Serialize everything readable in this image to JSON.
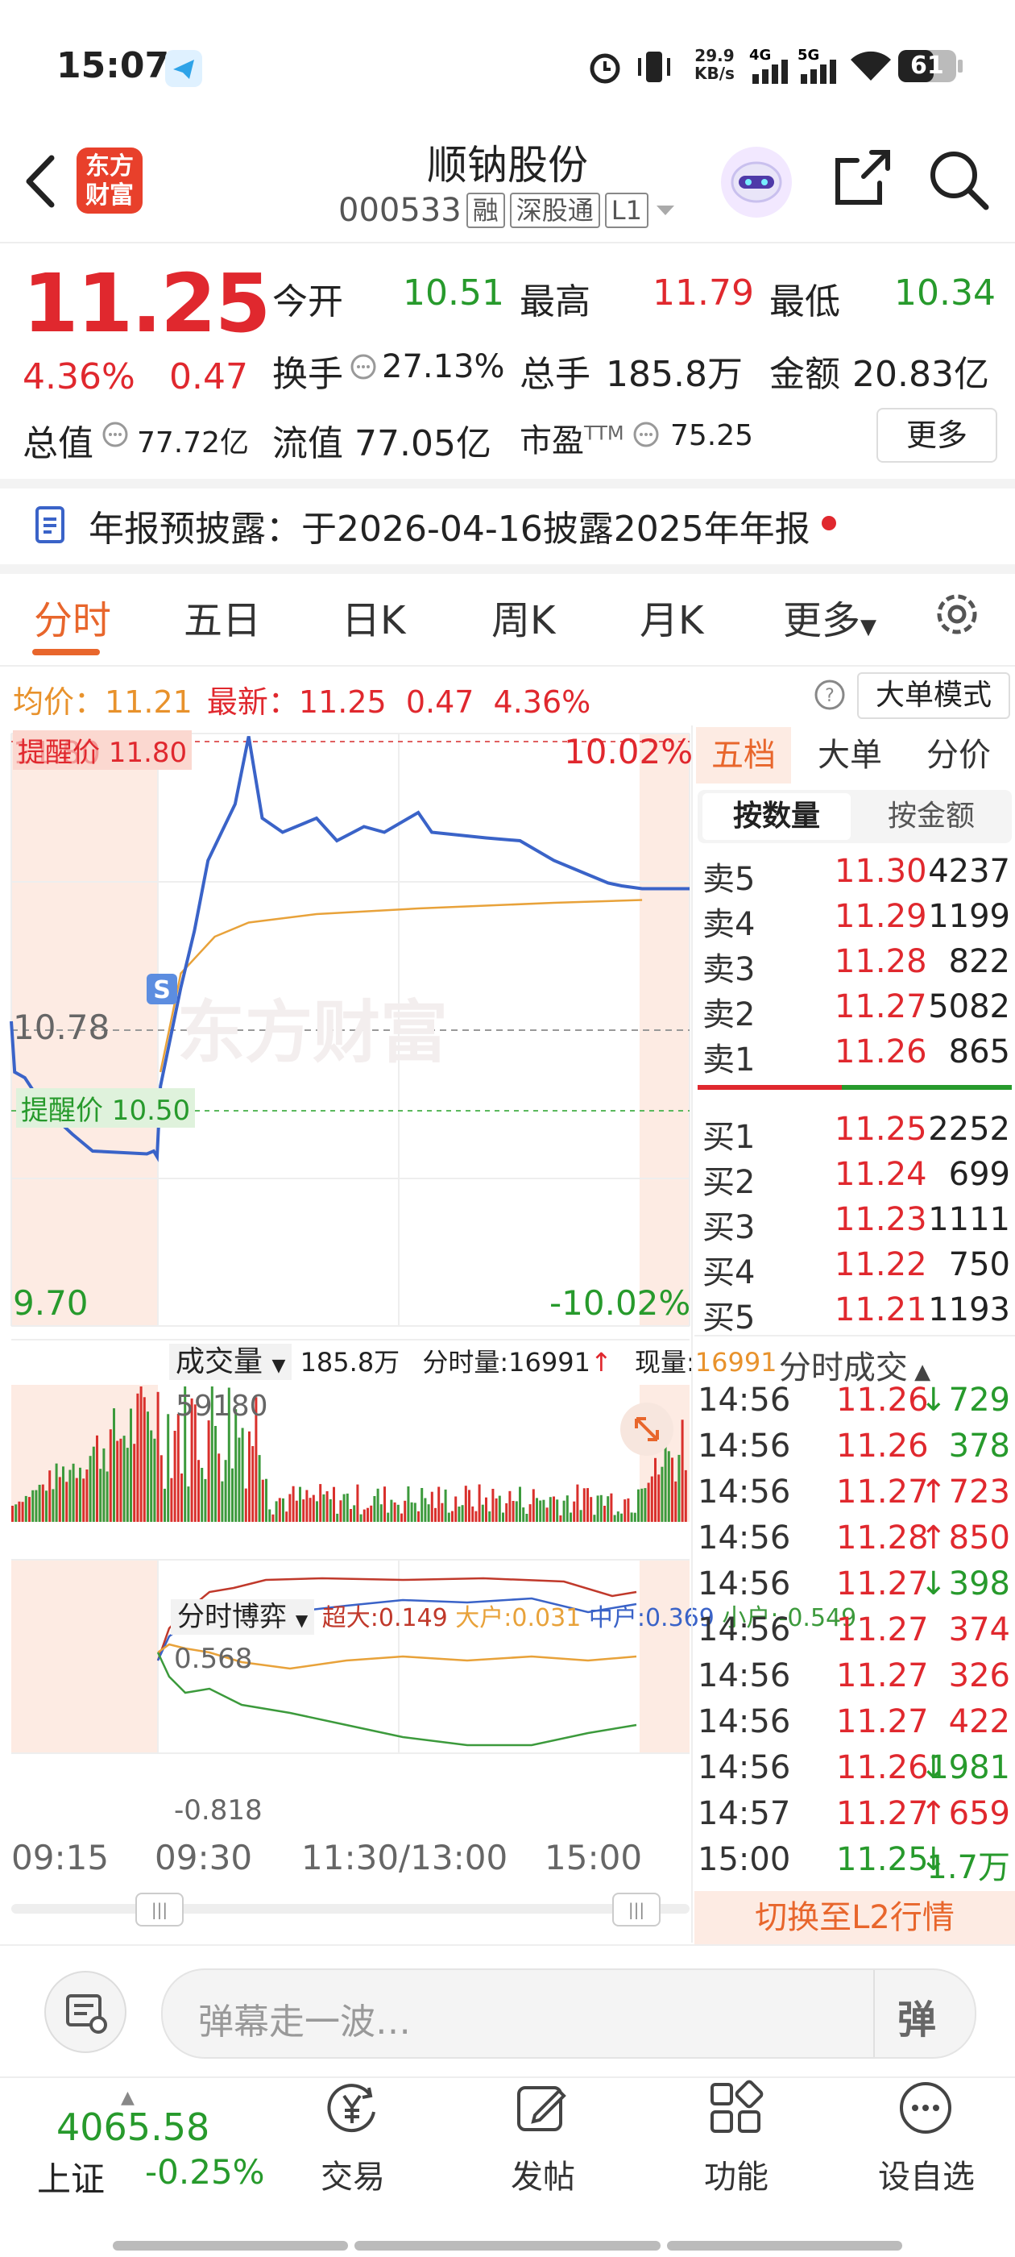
{
  "status_bar": {
    "time": "15:07",
    "net_speed_value": "29.9",
    "net_speed_unit": "KB/s",
    "net_4g": "4G",
    "net_5g": "5G",
    "battery": "61"
  },
  "header": {
    "title": "顺钠股份",
    "code": "000533",
    "tags": [
      "融",
      "深股通",
      "L1"
    ],
    "logo_text": "东方\n财富"
  },
  "quote": {
    "price": "11.25",
    "change_pct": "4.36%",
    "change": "0.47",
    "open_label": "今开",
    "open": "10.51",
    "high_label": "最高",
    "high": "11.79",
    "low_label": "最低",
    "low": "10.34",
    "turnover_label": "换手",
    "turnover": "27.13%",
    "volume_label": "总手",
    "volume": "185.8万",
    "amount_label": "金额",
    "amount": "20.83亿",
    "mcap_label": "总值",
    "mcap": "77.72亿",
    "float_label": "流值",
    "float": "77.05亿",
    "pe_label": "市盈",
    "pe_sup": "TTM",
    "pe": "75.25",
    "more_label": "更多"
  },
  "notice": {
    "text": "年报预披露：于2026-04-16披露2025年年报"
  },
  "tabs": [
    {
      "label": "分时",
      "active": true
    },
    {
      "label": "五日"
    },
    {
      "label": "日K"
    },
    {
      "label": "周K"
    },
    {
      "label": "月K"
    },
    {
      "label": "更多"
    }
  ],
  "info_line": {
    "avg_label": "均价：",
    "avg": "11.21",
    "last_label": "最新：",
    "last": "11.25",
    "chg": "0.47",
    "pct": "4.36%",
    "mode_button": "大单模式"
  },
  "chart_labels": {
    "top_price": "11.80",
    "alert_high": "提醒价 11.80",
    "top_pct": "10.02%",
    "mid_price": "10.78",
    "alert_low": "提醒价 10.50",
    "bottom_price": "9.70",
    "bottom_pct": "-10.02%",
    "watermark": "东方财富",
    "s_marker": "S"
  },
  "volume_bar": {
    "selector": "成交量",
    "total": "185.8万",
    "tick_label": "分时量:",
    "tick_value": "16991",
    "now_label": "现量:",
    "now_value": "16991",
    "max_label": "59180"
  },
  "game_bar": {
    "selector": "分时博弈",
    "super_label": "超大:",
    "super": "0.149",
    "big_label": "大户:",
    "big": "0.031",
    "mid_label": "中户:",
    "mid": "0.369",
    "small_label": "小户:",
    "small": "-0.549",
    "top_value": "0.568",
    "bottom_value": "-0.818"
  },
  "time_axis": [
    "09:15",
    "09:30",
    "11:30/13:00",
    "15:00"
  ],
  "chart_data": {
    "type": "line",
    "series": [],
    "price_points": [
      [
        0,
        10.78
      ],
      [
        0.005,
        10.6
      ],
      [
        0.02,
        10.58
      ],
      [
        0.05,
        10.47
      ],
      [
        0.09,
        10.38
      ],
      [
        0.12,
        10.32
      ],
      [
        0.2,
        10.31
      ],
      [
        0.21,
        10.32
      ],
      [
        0.215,
        10.3
      ],
      [
        0.22,
        10.55
      ],
      [
        0.25,
        10.9
      ],
      [
        0.27,
        11.1
      ],
      [
        0.29,
        11.35
      ],
      [
        0.31,
        11.45
      ],
      [
        0.33,
        11.55
      ],
      [
        0.35,
        11.79
      ],
      [
        0.37,
        11.5
      ],
      [
        0.4,
        11.45
      ],
      [
        0.45,
        11.5
      ],
      [
        0.48,
        11.42
      ],
      [
        0.52,
        11.47
      ],
      [
        0.55,
        11.45
      ],
      [
        0.6,
        11.52
      ],
      [
        0.62,
        11.45
      ],
      [
        0.7,
        11.43
      ],
      [
        0.75,
        11.42
      ],
      [
        0.8,
        11.35
      ],
      [
        0.85,
        11.3
      ],
      [
        0.88,
        11.27
      ],
      [
        0.9,
        11.26
      ],
      [
        0.93,
        11.25
      ],
      [
        1,
        11.25
      ]
    ],
    "avg_points": [
      [
        0.22,
        10.6
      ],
      [
        0.25,
        10.95
      ],
      [
        0.3,
        11.08
      ],
      [
        0.35,
        11.13
      ],
      [
        0.45,
        11.16
      ],
      [
        0.6,
        11.18
      ],
      [
        0.8,
        11.2
      ],
      [
        0.93,
        11.21
      ]
    ],
    "ylim": [
      9.7,
      11.8
    ]
  },
  "order_book": {
    "tabs": [
      "五档",
      "大单",
      "分价"
    ],
    "sub_tabs": [
      "按数量",
      "按金额"
    ],
    "asks": [
      {
        "label": "卖5",
        "price": "11.30",
        "qty": "4237"
      },
      {
        "label": "卖4",
        "price": "11.29",
        "qty": "1199"
      },
      {
        "label": "卖3",
        "price": "11.28",
        "qty": "822"
      },
      {
        "label": "卖2",
        "price": "11.27",
        "qty": "5082"
      },
      {
        "label": "卖1",
        "price": "11.26",
        "qty": "865"
      }
    ],
    "bids": [
      {
        "label": "买1",
        "price": "11.25",
        "qty": "2252"
      },
      {
        "label": "买2",
        "price": "11.24",
        "qty": "699"
      },
      {
        "label": "买3",
        "price": "11.23",
        "qty": "1111"
      },
      {
        "label": "买4",
        "price": "11.22",
        "qty": "750"
      },
      {
        "label": "买5",
        "price": "11.21",
        "qty": "1193"
      }
    ]
  },
  "ticks": {
    "title": "分时成交",
    "rows": [
      {
        "time": "14:56",
        "price": "11.26",
        "dir": "↓",
        "qty": "729",
        "color": "#279a2c"
      },
      {
        "time": "14:56",
        "price": "11.26",
        "dir": "",
        "qty": "378",
        "color": "#279a2c"
      },
      {
        "time": "14:56",
        "price": "11.27",
        "dir": "↑",
        "qty": "723",
        "color": "#e0282e"
      },
      {
        "time": "14:56",
        "price": "11.28",
        "dir": "↑",
        "qty": "850",
        "color": "#e0282e"
      },
      {
        "time": "14:56",
        "price": "11.27",
        "dir": "↓",
        "qty": "398",
        "color": "#279a2c"
      },
      {
        "time": "14:56",
        "price": "11.27",
        "dir": "",
        "qty": "374",
        "color": "#e0282e"
      },
      {
        "time": "14:56",
        "price": "11.27",
        "dir": "",
        "qty": "326",
        "color": "#e0282e"
      },
      {
        "time": "14:56",
        "price": "11.27",
        "dir": "",
        "qty": "422",
        "color": "#e0282e"
      },
      {
        "time": "14:56",
        "price": "11.26",
        "dir": "↓",
        "qty": "1981",
        "color": "#279a2c"
      },
      {
        "time": "14:57",
        "price": "11.27",
        "dir": "↑",
        "qty": "659",
        "color": "#e0282e"
      },
      {
        "time": "15:00",
        "price": "11.25",
        "dir": "↓",
        "qty": "1.7万",
        "color": "#279a2c"
      }
    ],
    "switch_l2": "切换至L2行情"
  },
  "comment_bar": {
    "placeholder": "弹幕走一波…",
    "danmu_button": "弹"
  },
  "bottom_nav": {
    "index_value": "4065.58",
    "index_name": "上证",
    "index_change": "-0.25%",
    "items": [
      {
        "label": "交易",
        "icon": "yuan-icon"
      },
      {
        "label": "发帖",
        "icon": "edit-icon"
      },
      {
        "label": "功能",
        "icon": "grid-icon"
      },
      {
        "label": "设自选",
        "icon": "more-icon"
      }
    ]
  }
}
